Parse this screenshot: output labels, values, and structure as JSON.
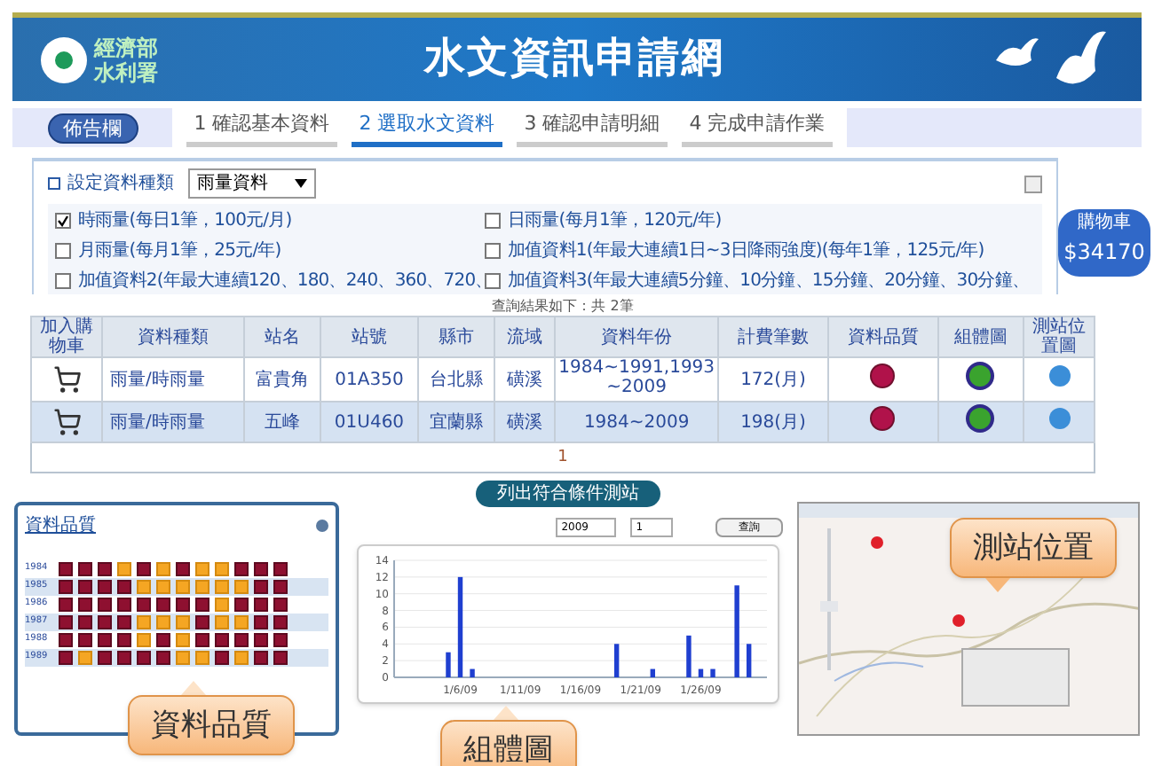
{
  "header": {
    "agency": [
      "經濟部",
      "水利署"
    ],
    "title": "水文資訊申請網"
  },
  "nav": {
    "notice": "佈告欄",
    "steps": [
      {
        "label": "1 確認基本資料",
        "selected": false
      },
      {
        "label": "2 選取水文資料",
        "selected": true
      },
      {
        "label": "3 確認申請明細",
        "selected": false
      },
      {
        "label": "4 完成申請作業",
        "selected": false
      }
    ]
  },
  "filter": {
    "label": "設定資料種類",
    "select": "雨量資料",
    "options": [
      {
        "label": "時雨量(每日1筆，100元/月)",
        "checked": true
      },
      {
        "label": "日雨量(每月1筆，120元/年)",
        "checked": false
      },
      {
        "label": "月雨量(每月1筆，25元/年)",
        "checked": false
      },
      {
        "label": "加值資料1(年最大連續1日~3日降雨強度)(每年1筆，125元/年)",
        "checked": false
      },
      {
        "label": "加值資料2(年最大連續120、180、240、360、720、",
        "checked": false
      },
      {
        "label": "加值資料3(年最大連續5分鐘、10分鐘、15分鐘、20分鐘、30分鐘、",
        "checked": false
      }
    ]
  },
  "cart": {
    "label": "購物車",
    "total": "$34170"
  },
  "results": {
    "caption": "查詢結果如下：共 2筆",
    "columns": [
      "加入購物車",
      "資料種類",
      "站名",
      "站號",
      "縣市",
      "流域",
      "資料年份",
      "計費筆數",
      "資料品質",
      "組體圖",
      "測站位置圖"
    ],
    "rows": [
      {
        "type": "雨量/時雨量",
        "station": "富貴角",
        "id": "01A350",
        "county": "台北縣",
        "basin": "磺溪",
        "years": "1984~1991,1993~2009",
        "count": "172(月)"
      },
      {
        "type": "雨量/時雨量",
        "station": "五峰",
        "id": "01U460",
        "county": "宜蘭縣",
        "basin": "磺溪",
        "years": "1984~2009",
        "count": "198(月)"
      }
    ],
    "page": "1"
  },
  "list_button": "列出符合條件測站",
  "quality": {
    "title": "資料品質",
    "rows": [
      {
        "year": "1984",
        "cells": [
          false,
          false,
          false,
          true,
          false,
          true,
          false,
          true,
          true,
          false,
          false,
          false
        ]
      },
      {
        "year": "1985",
        "cells": [
          false,
          false,
          false,
          false,
          true,
          true,
          true,
          true,
          true,
          true,
          false,
          false
        ]
      },
      {
        "year": "1986",
        "cells": [
          false,
          false,
          false,
          false,
          false,
          false,
          false,
          false,
          true,
          false,
          false,
          false
        ]
      },
      {
        "year": "1987",
        "cells": [
          false,
          false,
          false,
          false,
          true,
          true,
          true,
          false,
          true,
          true,
          false,
          false
        ]
      },
      {
        "year": "1988",
        "cells": [
          false,
          false,
          false,
          false,
          true,
          false,
          true,
          false,
          false,
          false,
          false,
          false
        ]
      },
      {
        "year": "1989",
        "cells": [
          false,
          true,
          false,
          false,
          false,
          false,
          true,
          true,
          false,
          true,
          false,
          false
        ]
      }
    ]
  },
  "chart_panel": {
    "year": "2009",
    "month": "1",
    "query": "查詢",
    "chart_data": {
      "type": "bar",
      "grid": true,
      "categories": [
        null,
        null,
        null,
        null,
        null,
        "1/6/09",
        null,
        null,
        null,
        null,
        "1/11/09",
        null,
        null,
        null,
        null,
        "1/16/09",
        null,
        null,
        null,
        null,
        "1/21/09",
        null,
        null,
        null,
        null,
        "1/26/09",
        null,
        null,
        null,
        null,
        null
      ],
      "series": [
        {
          "color": "#1f3fd0",
          "values": [
            0,
            0,
            0,
            0,
            3,
            12,
            1,
            0,
            0,
            0,
            0,
            0,
            0,
            0,
            0,
            0,
            0,
            0,
            4,
            0,
            0,
            1,
            0,
            0,
            5,
            1,
            1,
            0,
            11,
            4,
            0
          ]
        }
      ],
      "ylim": [
        0,
        14
      ],
      "yticks": [
        0,
        2,
        4,
        6,
        8,
        10,
        12,
        14
      ]
    }
  },
  "callouts": [
    "資料品質",
    "組體圖",
    "測站位置"
  ]
}
